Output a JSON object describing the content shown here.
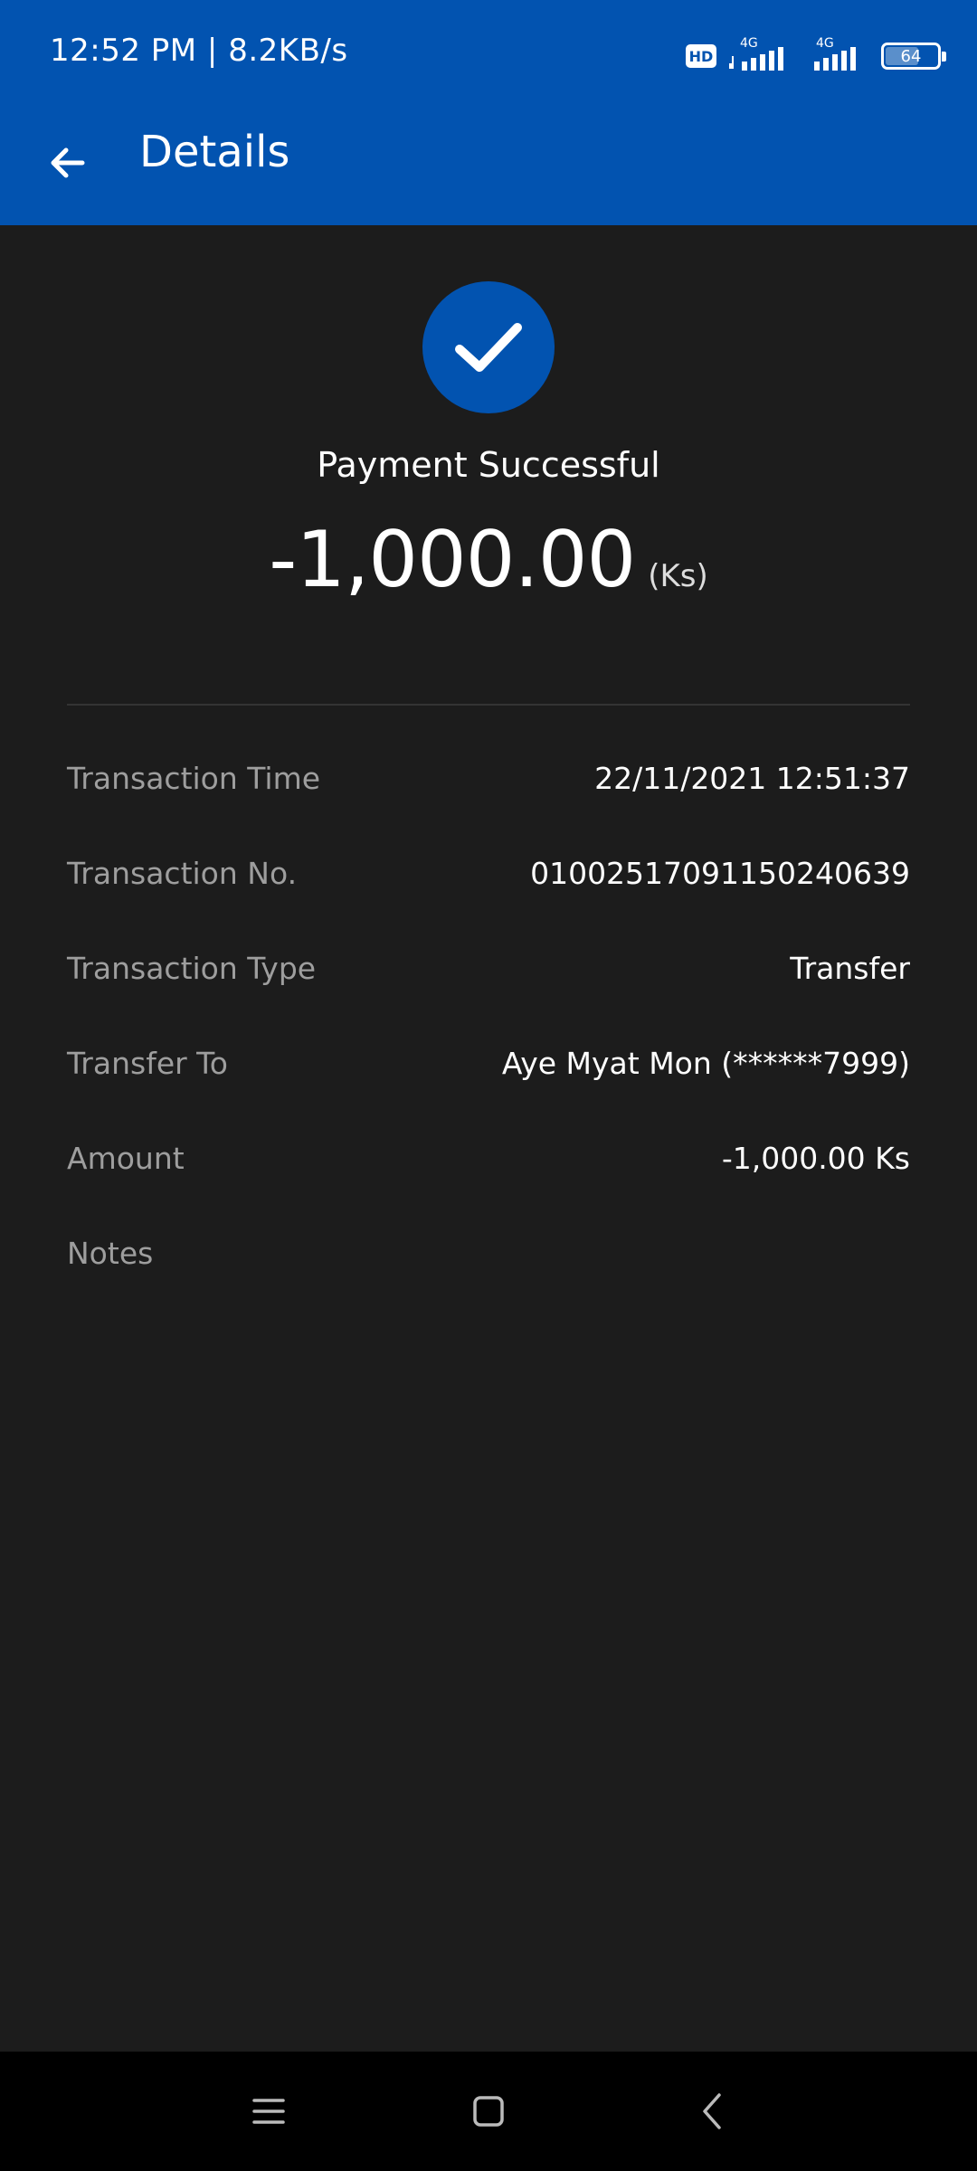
{
  "status_bar": {
    "time": "12:52 PM | 8.2KB/s",
    "hd_label": "HD",
    "network_1": "4G",
    "network_2": "4G",
    "battery_level": "64"
  },
  "app_bar": {
    "title": "Details",
    "back_icon": "arrow-left-icon"
  },
  "result": {
    "status_icon": "checkmark-icon",
    "status_text": "Payment Successful",
    "amount": "-1,000.00",
    "unit": "(Ks)"
  },
  "details": {
    "rows": [
      {
        "label": "Transaction Time",
        "value": "22/11/2021 12:51:37"
      },
      {
        "label": "Transaction No.",
        "value": "01002517091150240639"
      },
      {
        "label": "Transaction Type",
        "value": "Transfer"
      },
      {
        "label": "Transfer To",
        "value": "Aye Myat Mon (******7999)"
      },
      {
        "label": "Amount",
        "value": "-1,000.00 Ks"
      },
      {
        "label": "Notes",
        "value": ""
      }
    ]
  },
  "nav_bar": {
    "menu_icon": "menu-icon",
    "home_icon": "home-square-icon",
    "back_icon": "chevron-left-icon"
  },
  "colors": {
    "brand_blue": "#0253b0",
    "background": "#1c1c1c",
    "label_gray": "#9e9e9e"
  }
}
